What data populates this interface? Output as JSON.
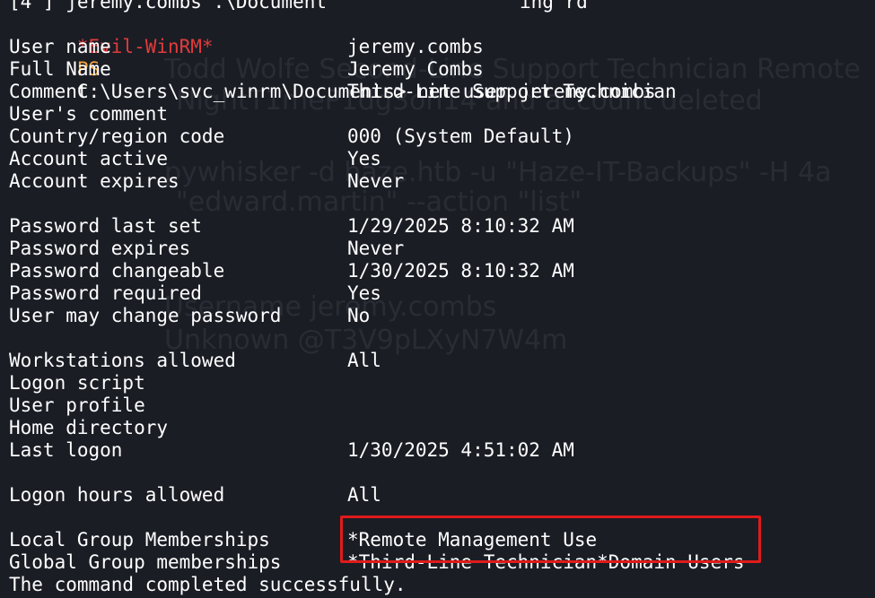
{
  "terminal": {
    "top_partial": "[4 ] jeremy.combs .\\Document                 ing rd",
    "prompt": {
      "shell": "*Evil-WinRM*",
      "ps": "PS",
      "path_command": "C:\\Users\\svc_winrm\\Documents> net user jeremy.combs"
    },
    "rows": [
      {
        "key": "User name",
        "value": "jeremy.combs"
      },
      {
        "key": "Full Name",
        "value": "Jeremy Combs"
      },
      {
        "key": "Comment",
        "value": "Third-Line Support Technician"
      },
      {
        "key": "User's comment",
        "value": ""
      },
      {
        "key": "Country/region code",
        "value": "000 (System Default)"
      },
      {
        "key": "Account active",
        "value": "Yes"
      },
      {
        "key": "Account expires",
        "value": "Never"
      }
    ],
    "rows2": [
      {
        "key": "Password last set",
        "value": "1/29/2025 8:10:32 AM"
      },
      {
        "key": "Password expires",
        "value": "Never"
      },
      {
        "key": "Password changeable",
        "value": "1/30/2025 8:10:32 AM"
      },
      {
        "key": "Password required",
        "value": "Yes"
      },
      {
        "key": "User may change password",
        "value": "No"
      }
    ],
    "rows3": [
      {
        "key": "Workstations allowed",
        "value": "All"
      },
      {
        "key": "Logon script",
        "value": ""
      },
      {
        "key": "User profile",
        "value": ""
      },
      {
        "key": "Home directory",
        "value": ""
      },
      {
        "key": "Last logon",
        "value": "1/30/2025 4:51:02 AM"
      }
    ],
    "rows4": [
      {
        "key": "Logon hours allowed",
        "value": "All"
      }
    ],
    "groups": [
      {
        "key": "Local Group Memberships",
        "value": "*Remote Management Use"
      },
      {
        "key": "Global Group memberships",
        "value": "*Third-Line Technician*Domain Users"
      }
    ],
    "completion": "The command completed successfully.",
    "colors": {
      "background": "#1b1d25",
      "text": "#ffffff",
      "prompt_shell": "#e23b3b",
      "prompt_ps": "#f2a33a",
      "highlight_border": "#e01b1b"
    }
  },
  "background_ghost": {
    "lines": [
      "Todd Wolfe         Second-Line Support Technician Remote",
      "NightT1meP1dg3on14 and account deleted",
      "pywhisker -d haze.htb -u \"Haze-IT-Backups\" -H 4a",
      "\"edward.martin\" --action \"list\"",
      "Username      jeremy.combs",
      "Unknown       @T3V9pLXyN7W4m"
    ]
  }
}
